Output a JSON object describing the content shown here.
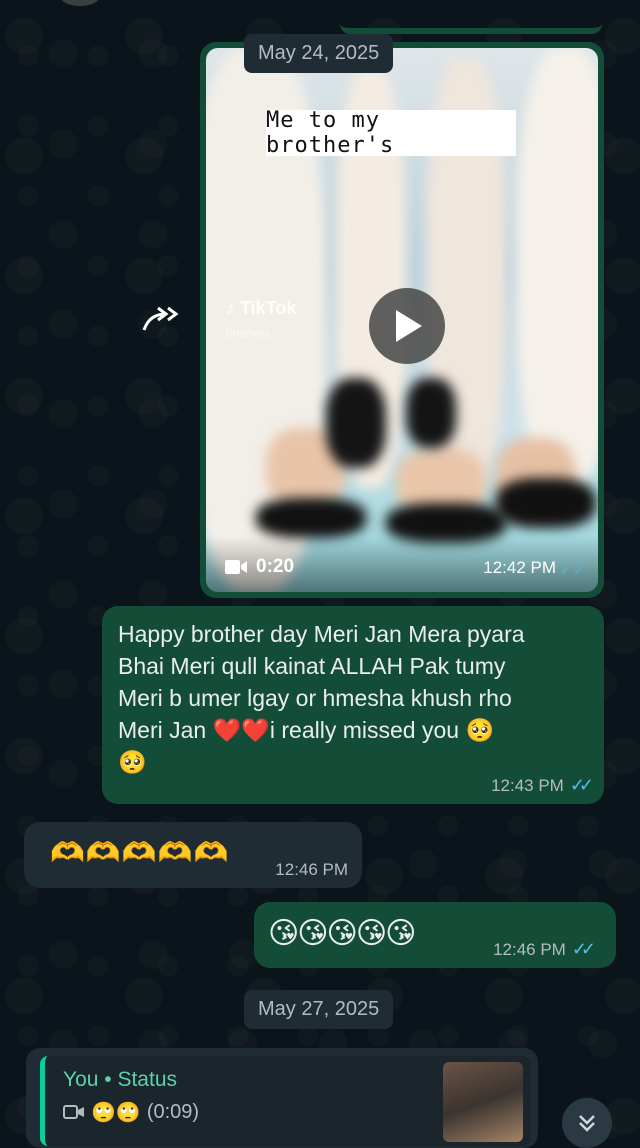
{
  "chat": {
    "date_top": "May 24, 2025",
    "video_message": {
      "caption": "Me to my brother's",
      "watermark": "TikTok",
      "watermark_sub": "brothers",
      "duration": "0:20",
      "time": "12:42 PM"
    },
    "message1": {
      "text_line1": "Happy brother day Meri Jan Mera pyara",
      "text_line2": "Bhai Meri qull kainat ALLAH Pak tumy",
      "text_line3": "Meri b umer lgay or hmesha khush rho",
      "text_line4_a": "Meri Jan ",
      "text_line4_emojis": "❤️❤️",
      "text_line4_b": "i really missed you 🥺",
      "text_line5": "🥺",
      "time": "12:43 PM"
    },
    "message2": {
      "text": "🫶🫶🫶🫶🫶",
      "time": "12:46 PM"
    },
    "message3": {
      "text": "😘😘😘😘😘",
      "time": "12:46 PM"
    },
    "date_bottom": "May 27, 2025",
    "status_reply": {
      "title": "You • Status",
      "emojis": "🙄🙄",
      "duration": "(0:09)"
    }
  },
  "icons": {
    "forward": "forward-icon",
    "play": "play-icon",
    "video": "video-camera-icon",
    "read_receipt": "double-check-icon",
    "scroll": "chevron-double-down-icon"
  },
  "colors": {
    "background": "#0b141a",
    "outgoing_bubble": "#144d37",
    "incoming_bubble": "#1f2c34",
    "read_tick": "#53bdeb",
    "status_accent": "#06cf9c"
  }
}
